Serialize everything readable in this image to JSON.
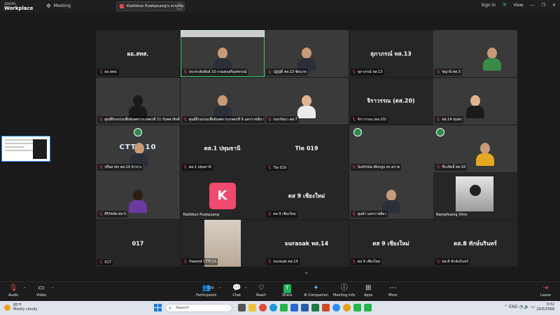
{
  "app": {
    "brand_line1": "zoom",
    "brand_line2": "Workplace",
    "meeting_label": "Meeting",
    "screen_share_label": "Kiattikun Puakpuang's screen",
    "sign_in": "Sign in",
    "view": "View",
    "accent": "#2d8cff",
    "active_speaker_color": "#35c759"
  },
  "tiles": [
    {
      "id": "t1",
      "type": "name",
      "center": "ผอ.สทส.",
      "name": "ผอ.สทส."
    },
    {
      "id": "t2",
      "type": "video",
      "name": "ประชาสัมพันธ์ 10 กรมส่งเสริมสหกรณ์",
      "active": true
    },
    {
      "id": "t3",
      "type": "video",
      "name": "ปฏิญ์ดี ศส.13 ชัยนาท"
    },
    {
      "id": "t4",
      "type": "name",
      "center": "สุภาภรณ์ ทส.13",
      "name": "สุภาภรณ์ ทส.13"
    },
    {
      "id": "t5",
      "type": "video",
      "name": "ชญานี ศส.3"
    },
    {
      "id": "t6",
      "type": "video",
      "name": "ศูนย์ฝึกอบรมเพื่อนิเทศการเกษตรที่ 11 กัมพลาสิทธิ์"
    },
    {
      "id": "t7",
      "type": "video",
      "name": "ศูนย์ฝึกอบรมเพื่อนิเทศการเกษตรที่ 9 นครราชสีมา"
    },
    {
      "id": "t8",
      "type": "video",
      "name": "กนกรัตนา ศส.7"
    },
    {
      "id": "t9",
      "type": "name",
      "center": "จิราวรรณ (ตส.20)",
      "name": "จิราวรรณ (ตส.20)"
    },
    {
      "id": "t10",
      "type": "video",
      "name": "ศส.14 ชุมพร"
    },
    {
      "id": "t11",
      "type": "video",
      "name": "ปรียมาพร ศส.10 ลำปาง",
      "banner": "CTTC 10"
    },
    {
      "id": "t12",
      "type": "name",
      "center": "ตส.1 ปทุมธานี",
      "name": "ตส.1 ปทุมธานี"
    },
    {
      "id": "t13",
      "type": "name",
      "center": "Tle 019",
      "name": "Tle 019"
    },
    {
      "id": "t14",
      "type": "video",
      "name": "Sutthida Wongs ศร.ตราด"
    },
    {
      "id": "t15",
      "type": "video",
      "name": "ชีระยิทธิ์ ศส.16"
    },
    {
      "id": "t16",
      "type": "video",
      "name": "ศิริรัชชัย ศส.5"
    },
    {
      "id": "t17",
      "type": "avatar",
      "avatar_letter": "K",
      "name": "Kiattikun Puakpuang"
    },
    {
      "id": "t18",
      "type": "name",
      "center": "ตส 9 เชียงใหม่",
      "name": "ตส 9 เชียงใหม่"
    },
    {
      "id": "t19",
      "type": "video",
      "name": "ศูนย์ฯ นครราชสีมา"
    },
    {
      "id": "t20",
      "type": "video",
      "name": "Namphueng Vims"
    },
    {
      "id": "t21",
      "type": "name",
      "center": "017",
      "name": "017"
    },
    {
      "id": "t22",
      "type": "video",
      "name": "กันตพงษ์ CTTC15"
    },
    {
      "id": "t23",
      "type": "name",
      "center": "surasak ทส.14",
      "name": "surasak ศส.14"
    },
    {
      "id": "t24",
      "type": "name",
      "center": "ตส 9 เชียงใหม่",
      "name": "ตส 9 เชียงใหม่"
    },
    {
      "id": "t25",
      "type": "name",
      "center": "ตส.8 ทักษ์นรินทร์",
      "name": "ตส.8 ทักษ์นรินทร์"
    }
  ],
  "toolbar": {
    "audio": "Audio",
    "video": "Video",
    "participants": "Participants",
    "participants_count": "29",
    "chat": "Chat",
    "react": "React",
    "share": "Share",
    "ai_companion": "AI Companion",
    "meeting_info": "Meeting info",
    "apps": "Apps",
    "more": "More",
    "leave": "Leave"
  },
  "taskbar": {
    "weather_temp": "85°F",
    "weather_desc": "Mostly cloudy",
    "search_placeholder": "Search",
    "time": "9:52",
    "date": "29/5/2568",
    "lang": "ENG"
  }
}
